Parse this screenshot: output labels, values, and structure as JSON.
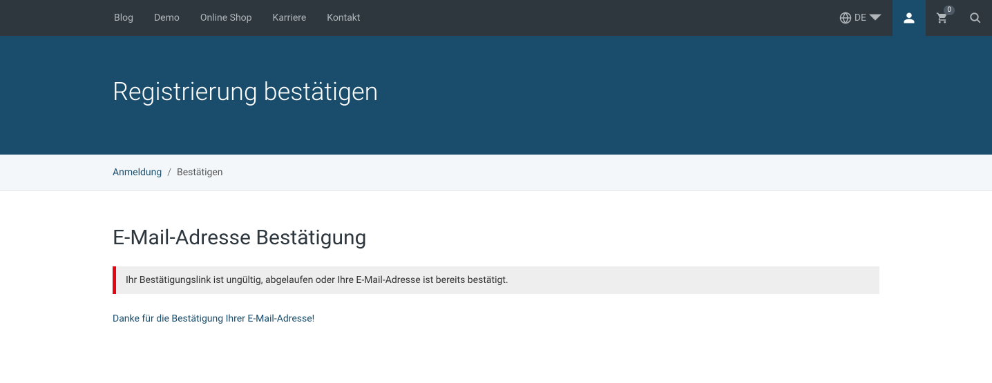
{
  "nav": {
    "items": [
      "Blog",
      "Demo",
      "Online Shop",
      "Karriere",
      "Kontakt"
    ],
    "lang": "DE",
    "cart_count": "0"
  },
  "hero": {
    "title": "Registrierung bestätigen"
  },
  "breadcrumb": {
    "link": "Anmeldung",
    "separator": "/",
    "current": "Bestätigen"
  },
  "main": {
    "heading": "E-Mail-Adresse Bestätigung",
    "alert": "Ihr Bestätigungslink ist ungültig, abgelaufen oder Ihre E-Mail-Adresse ist bereits bestätigt.",
    "thanks": "Danke für die Bestätigung Ihrer E-Mail-Adresse!"
  }
}
